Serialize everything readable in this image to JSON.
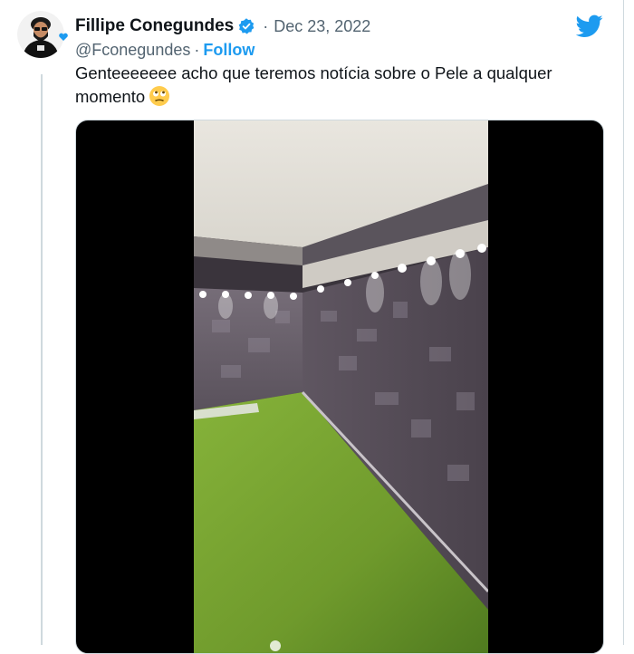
{
  "tweet": {
    "display_name": "Fillipe Conegundes",
    "date": "Dec 23, 2022",
    "separator": "·",
    "handle": "@Fconegundes",
    "handle_separator": "·",
    "follow_label": "Follow",
    "text": "Genteeeeeee acho que teremos notícia sobre o Pele a qualquer momento",
    "verified": true
  },
  "icons": {
    "verified": "verified-badge-icon",
    "brand": "twitter-bird-icon",
    "emoji": "face-with-rolling-eyes-emoji",
    "video": "video-thumbnail"
  },
  "colors": {
    "link": "#1d9bf0",
    "secondary_text": "#536471",
    "primary_text": "#0f1419",
    "border": "#cfd9de"
  }
}
